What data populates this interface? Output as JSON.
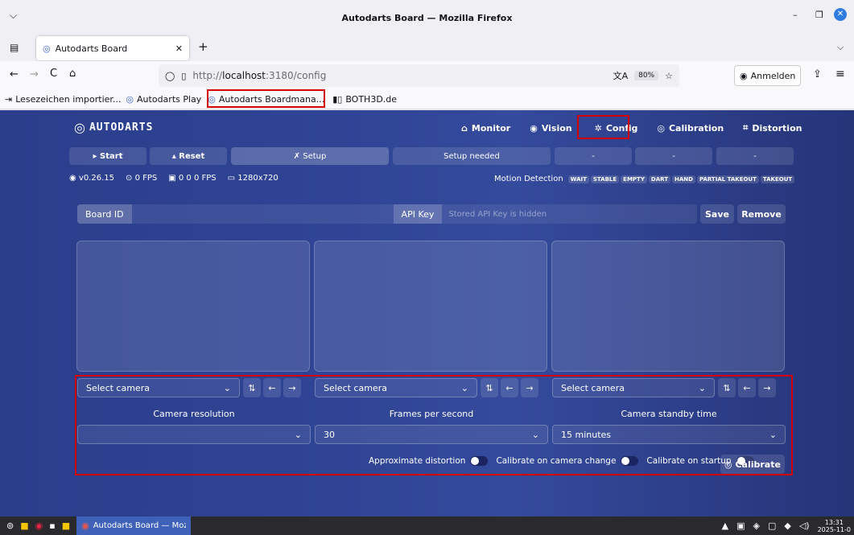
{
  "window": {
    "title": "Autodarts Board — Mozilla Firefox"
  },
  "tab": {
    "label": "Autodarts Board"
  },
  "nav": {
    "url_prefix": "http://",
    "url_host": "localhost",
    "url_rest": ":3180/config",
    "zoom": "80%",
    "signin": "Anmelden"
  },
  "bookmarks": [
    "Lesezeichen importier...",
    "Autodarts Play",
    "Autodarts Boardmana...",
    "BOTH3D.de"
  ],
  "app": {
    "logo": "AUTODARTS",
    "menu": [
      "Monitor",
      "Vision",
      "Config",
      "Calibration",
      "Distortion"
    ],
    "start": "Start",
    "reset": "Reset",
    "setup": "Setup",
    "setup_needed": "Setup needed",
    "status": {
      "version": "v0.26.15",
      "fps1": "0 FPS",
      "fps2": "0 0 0 FPS",
      "res": "1280x720"
    },
    "motion_label": "Motion Detection",
    "motion_states": [
      "WAIT",
      "STABLE",
      "EMPTY",
      "DART",
      "HAND",
      "PARTIAL TAKEOUT",
      "TAKEOUT"
    ],
    "board_id_label": "Board ID",
    "api_key_label": "API Key",
    "api_key_placeholder": "Stored API Key is hidden",
    "save": "Save",
    "remove": "Remove",
    "select_camera": "Select camera",
    "resolution_label": "Camera resolution",
    "fps_label": "Frames per second",
    "standby_label": "Camera standby time",
    "fps_value": "30",
    "standby_value": "15 minutes",
    "approx": "Approximate distortion",
    "cal_change": "Calibrate on camera change",
    "cal_startup": "Calibrate on startup",
    "calibrate": "Calibrate"
  },
  "taskbar": {
    "app": "Autodarts Board — Mozill...",
    "time": "13:31",
    "date": "2025-11-0"
  }
}
